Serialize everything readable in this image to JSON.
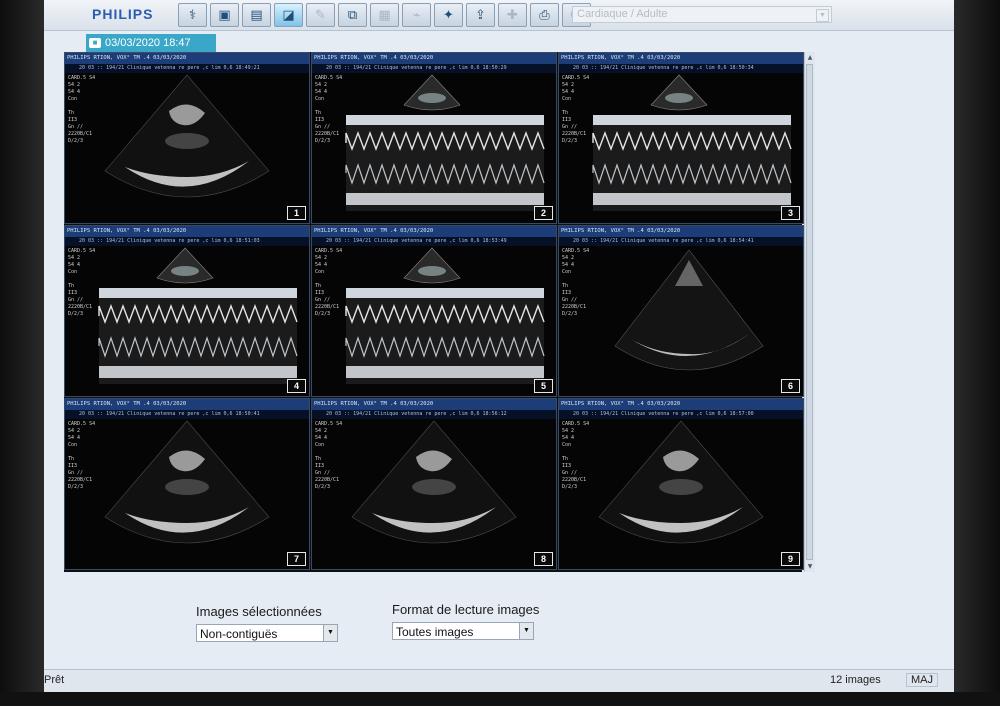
{
  "app": {
    "brand": "PHILIPS"
  },
  "toolbar": {
    "tools": [
      {
        "icon": "patient-icon",
        "glyph": "⚕",
        "state": "normal"
      },
      {
        "icon": "save-icon",
        "glyph": "▣",
        "state": "normal"
      },
      {
        "icon": "image-review-icon",
        "glyph": "▤",
        "state": "normal"
      },
      {
        "icon": "review-active-icon",
        "glyph": "◪",
        "state": "active"
      },
      {
        "icon": "measure-icon",
        "glyph": "✎",
        "state": "dim"
      },
      {
        "icon": "copy-icon",
        "glyph": "⧉",
        "state": "normal"
      },
      {
        "icon": "report-icon",
        "glyph": "▦",
        "state": "dim"
      },
      {
        "icon": "probe-icon",
        "glyph": "⌁",
        "state": "dim"
      },
      {
        "icon": "tools-icon",
        "glyph": "✦",
        "state": "normal"
      },
      {
        "icon": "transfer-icon",
        "glyph": "⇪",
        "state": "normal"
      },
      {
        "icon": "settings-icon",
        "glyph": "✚",
        "state": "dim"
      },
      {
        "icon": "print-icon",
        "glyph": "⎙",
        "state": "normal"
      },
      {
        "icon": "user-icon",
        "glyph": "☺",
        "state": "dim"
      }
    ],
    "mode": "Cardiaque / Adulte"
  },
  "study": {
    "date_tab": "03/03/2020 18:47"
  },
  "images": [
    {
      "number": "1",
      "type": "2d",
      "header": "PHILIPS  RTION, VOX°         TM .4  03/03/2020",
      "header2": "20 03 :: 194/21  Clinique vetenna re pere ,c lim 0,6  18:49:21"
    },
    {
      "number": "2",
      "type": "mmode",
      "header": "PHILIPS  RTION, VOX°         TM .4  03/03/2020",
      "header2": "20 03 :: 194/21  Clinique vetenna re pere ,c lim 0,6  18:50:29"
    },
    {
      "number": "3",
      "type": "mmode",
      "header": "PHILIPS  RTION, VOX°         TM .4  03/03/2020",
      "header2": "20 03 :: 194/21  Clinique vetenna re pere ,c lim 0,6  18:50:34"
    },
    {
      "number": "4",
      "type": "mmode",
      "header": "PHILIPS  RTION, VOX°         TM .4  03/03/2020",
      "header2": "20 03 :: 194/21  Clinique vetenna re pere ,c lim 0,6  18:51:03"
    },
    {
      "number": "5",
      "type": "mmode",
      "header": "PHILIPS  RTION, VOX°         TM .4  03/03/2020",
      "header2": "20 03 :: 194/21  Clinique vetenna re pere ,c lim 0,6  18:53:49"
    },
    {
      "number": "6",
      "type": "sector",
      "header": "PHILIPS  RTION, VOX°         TM .4  03/03/2020",
      "header2": "20 03 :: 194/21  Clinique vetenna re pere ,c lim 0,6  18:54:41"
    },
    {
      "number": "7",
      "type": "2d",
      "header": "PHILIPS  RTION, VOX°         TM .4  03/03/2020",
      "header2": "20 03 :: 194/21  Clinique vetenna re pere ,c lim 0,6  18:50:41"
    },
    {
      "number": "8",
      "type": "2d",
      "header": "PHILIPS  RTION, VOX°         TM .4  03/03/2020",
      "header2": "20 03 :: 194/21  Clinique vetenna re pere ,c lim 0,6  18:56:12"
    },
    {
      "number": "9",
      "type": "2d",
      "header": "PHILIPS  RTION, VOX°         TM .4  03/03/2020",
      "header2": "20 03 :: 194/21  Clinique vetenna re pere ,c lim 0,6  18:57:00"
    }
  ],
  "params_text": "CARD.5 S4\n54 2\n54 4\nCon\n\nTh\nII3\nGn //\n2220B/C1\nD/2/3",
  "controls": {
    "selected_label": "Images sélectionnées",
    "selected_value": "Non-contiguës",
    "format_label": "Format de lecture images",
    "format_value": "Toutes images"
  },
  "status": {
    "left": "Prêt",
    "count": "12 images",
    "caps": "MAJ"
  }
}
